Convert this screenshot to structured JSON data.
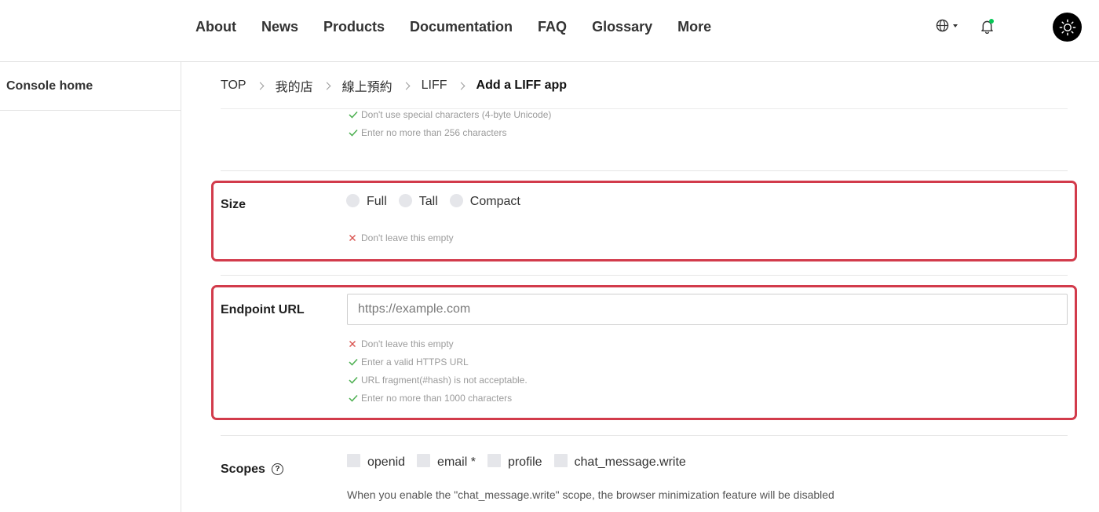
{
  "nav": {
    "links": [
      "About",
      "News",
      "Products",
      "Documentation",
      "FAQ",
      "Glossary",
      "More"
    ],
    "globe_icon": "globe-icon",
    "bell_icon": "bell-icon",
    "theme_icon": "sun-icon",
    "notification_dot_color": "#06c755"
  },
  "sidebar": {
    "items": [
      {
        "label": "Console home"
      }
    ]
  },
  "breadcrumb": {
    "items": [
      "TOP",
      "我的店",
      "線上預約",
      "LIFF"
    ],
    "current": "Add a LIFF app"
  },
  "name_rules": [
    {
      "status": "ok",
      "text": "Don't use special characters (4-byte Unicode)"
    },
    {
      "status": "ok",
      "text": "Enter no more than 256 characters"
    }
  ],
  "size": {
    "label": "Size",
    "options": [
      "Full",
      "Tall",
      "Compact"
    ],
    "rules": [
      {
        "status": "error",
        "text": "Don't leave this empty"
      }
    ]
  },
  "endpoint": {
    "label": "Endpoint URL",
    "placeholder": "https://example.com",
    "value": "",
    "rules": [
      {
        "status": "error",
        "text": "Don't leave this empty"
      },
      {
        "status": "ok",
        "text": "Enter a valid HTTPS URL"
      },
      {
        "status": "ok",
        "text": "URL fragment(#hash) is not acceptable."
      },
      {
        "status": "ok",
        "text": "Enter no more than 1000 characters"
      }
    ]
  },
  "scopes": {
    "label": "Scopes",
    "help_icon": "question-circle-icon",
    "options": [
      "openid",
      "email *",
      "profile",
      "chat_message.write"
    ],
    "note": "When you enable the \"chat_message.write\" scope, the browser minimization feature will be disabled"
  },
  "colors": {
    "error_border": "#d23b4b",
    "ok_check": "#4caf50",
    "error_x": "#d9534f"
  }
}
